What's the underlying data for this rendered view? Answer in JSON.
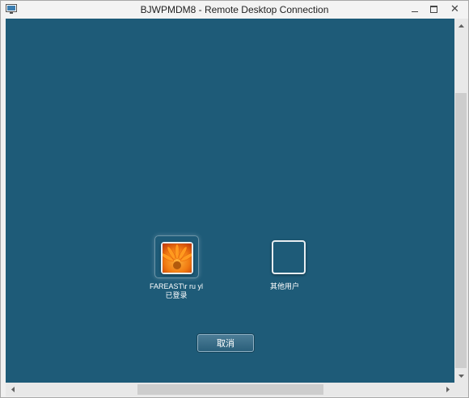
{
  "window": {
    "title": "BJWPMDM8 - Remote Desktop Connection",
    "minimize_glyph": "minimize-icon",
    "maximize_glyph": "maximize-icon",
    "close_glyph": "✕"
  },
  "colors": {
    "remote_background": "#1e5b78",
    "titlebar": "#f3f3f3"
  },
  "logon": {
    "users": [
      {
        "name": "FAREAST\\r ru yl",
        "status": "已登录",
        "avatar": "flower-avatar"
      },
      {
        "name": "其他用户",
        "avatar": "blank-avatar"
      }
    ],
    "cancel_label": "取消"
  },
  "scrollbars": {
    "vertical": true,
    "horizontal": true
  }
}
